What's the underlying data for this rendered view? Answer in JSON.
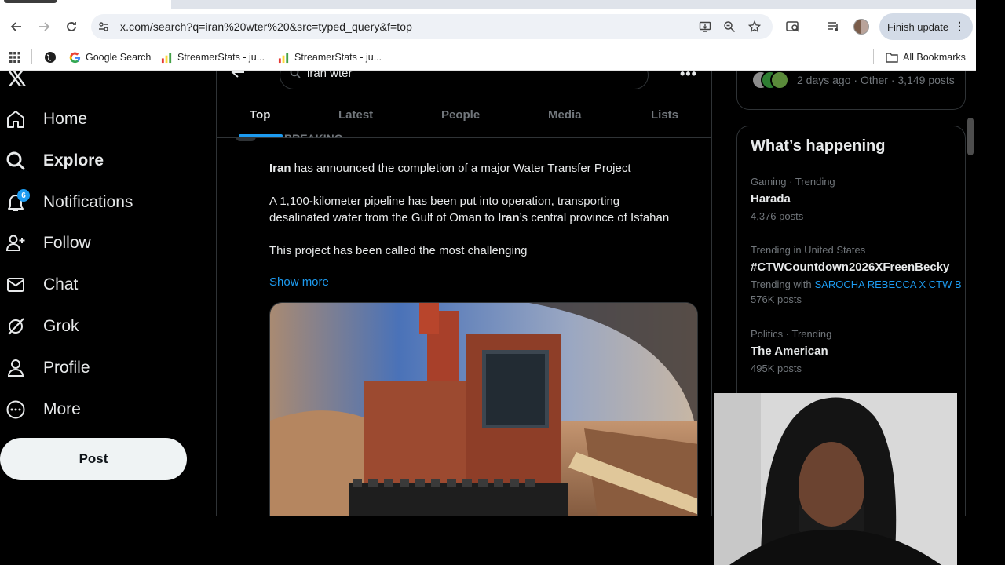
{
  "browser": {
    "url": "x.com/search?q=iran%20wter%20&src=typed_query&f=top",
    "finish_update": "Finish update",
    "bookmarks": [
      {
        "label": "Google Search"
      },
      {
        "label": "StreamerStats - ju..."
      },
      {
        "label": "StreamerStats - ju..."
      }
    ],
    "all_bookmarks": "All Bookmarks"
  },
  "nav": {
    "items": [
      {
        "label": "Home",
        "icon": "home-icon"
      },
      {
        "label": "Explore",
        "icon": "search-icon"
      },
      {
        "label": "Notifications",
        "icon": "bell-icon",
        "badge": "6"
      },
      {
        "label": "Follow",
        "icon": "follow-icon"
      },
      {
        "label": "Chat",
        "icon": "mail-icon"
      },
      {
        "label": "Grok",
        "icon": "grok-icon"
      },
      {
        "label": "Profile",
        "icon": "person-icon"
      },
      {
        "label": "More",
        "icon": "more-circle-icon"
      }
    ],
    "post_label": "Post"
  },
  "search": {
    "value": "iran wter"
  },
  "tabs": [
    "Top",
    "Latest",
    "People",
    "Media",
    "Lists"
  ],
  "tweet": {
    "header_partial": "BREAKING",
    "para1_bold": "Iran",
    "para1_rest": " has announced the completion of a major Water Transfer Project",
    "para2_a": "A 1,100-kilometer pipeline has been put into operation, transporting desalinated water from the Gulf of Oman to ",
    "para2_bold": "Iran",
    "para2_b": "’s central province of Isfahan",
    "para3": "This project has been called the most challenging",
    "show_more": "Show more"
  },
  "community": {
    "meta": "2 days ago · Other · 3,149 posts"
  },
  "happening": {
    "title": "What’s happening",
    "trends": [
      {
        "category": "Gaming · Trending",
        "name": "Harada",
        "count": "4,376 posts"
      },
      {
        "category": "Trending in United States",
        "name": "#CTWCountdown2026XFreenBecky",
        "with_label": "Trending with",
        "with_value": "SAROCHA REBECCA X CTW B",
        "count": "576K posts"
      },
      {
        "category": "Politics · Trending",
        "name": "The American",
        "count": "495K posts"
      }
    ]
  },
  "colors": {
    "accent": "#1d9bf0",
    "background": "#000000",
    "text": "#e7e9ea",
    "muted": "#71767b"
  }
}
